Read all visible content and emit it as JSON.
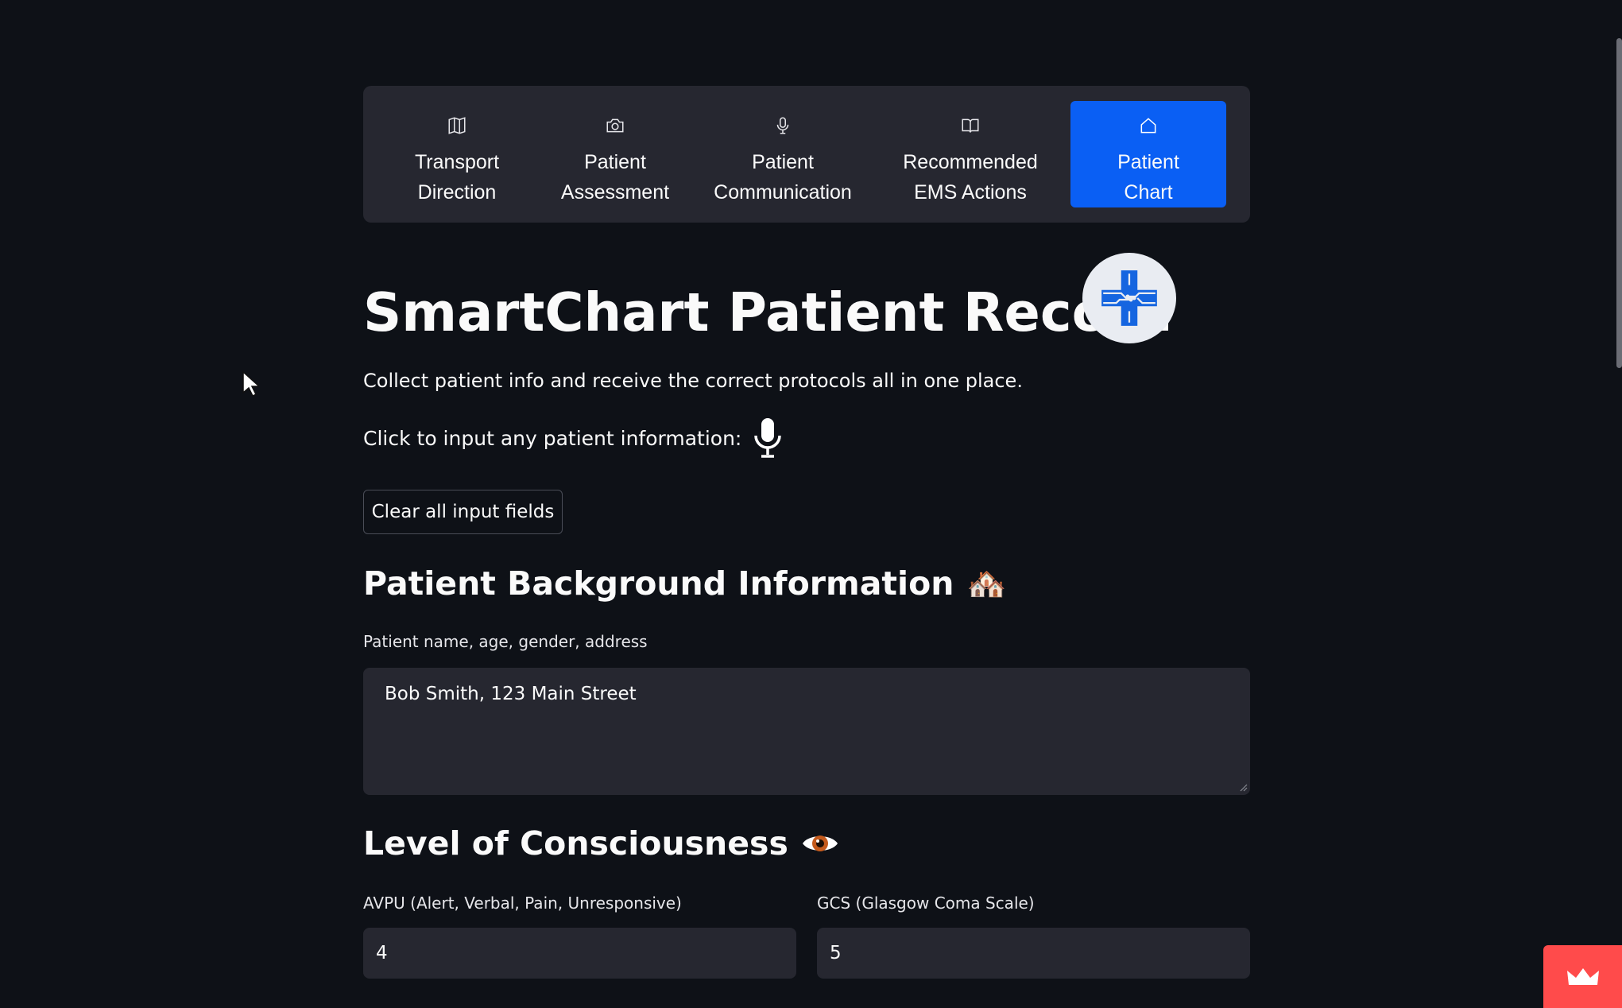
{
  "nav": {
    "items": [
      {
        "label": "Transport\nDirection",
        "icon": "map-icon",
        "active": false
      },
      {
        "label": "Patient\nAssessment",
        "icon": "camera-icon",
        "active": false
      },
      {
        "label": "Patient\nCommunication",
        "icon": "microphone-icon",
        "active": false
      },
      {
        "label": "Recommended\nEMS Actions",
        "icon": "book-icon",
        "active": false
      },
      {
        "label": "Patient\nChart",
        "icon": "house-icon",
        "active": true
      }
    ],
    "active_color": "#0a5ff4"
  },
  "header": {
    "title": "SmartChart Patient Record",
    "logo_icon": "medical-cross-circuit-icon",
    "subtitle": "Collect patient info and receive the correct protocols all in one place.",
    "mic_prompt": "Click to input any patient information:",
    "mic_icon": "microphone-icon"
  },
  "actions": {
    "clear_label": "Clear all input fields"
  },
  "background_section": {
    "heading": "Patient Background Information",
    "emoji": "🏘️",
    "field_label": "Patient name, age, gender, address",
    "field_value": "Bob Smith, 123 Main Street"
  },
  "consciousness_section": {
    "heading": "Level of Consciousness",
    "emoji": "👁️",
    "avpu_label": "AVPU (Alert, Verbal, Pain, Unresponsive)",
    "avpu_value": "4",
    "gcs_label": "GCS (Glasgow Coma Scale)",
    "gcs_value": "5"
  },
  "theme": {
    "background": "#0e1117",
    "surface": "#262730",
    "badge": "#ff4b4b"
  }
}
